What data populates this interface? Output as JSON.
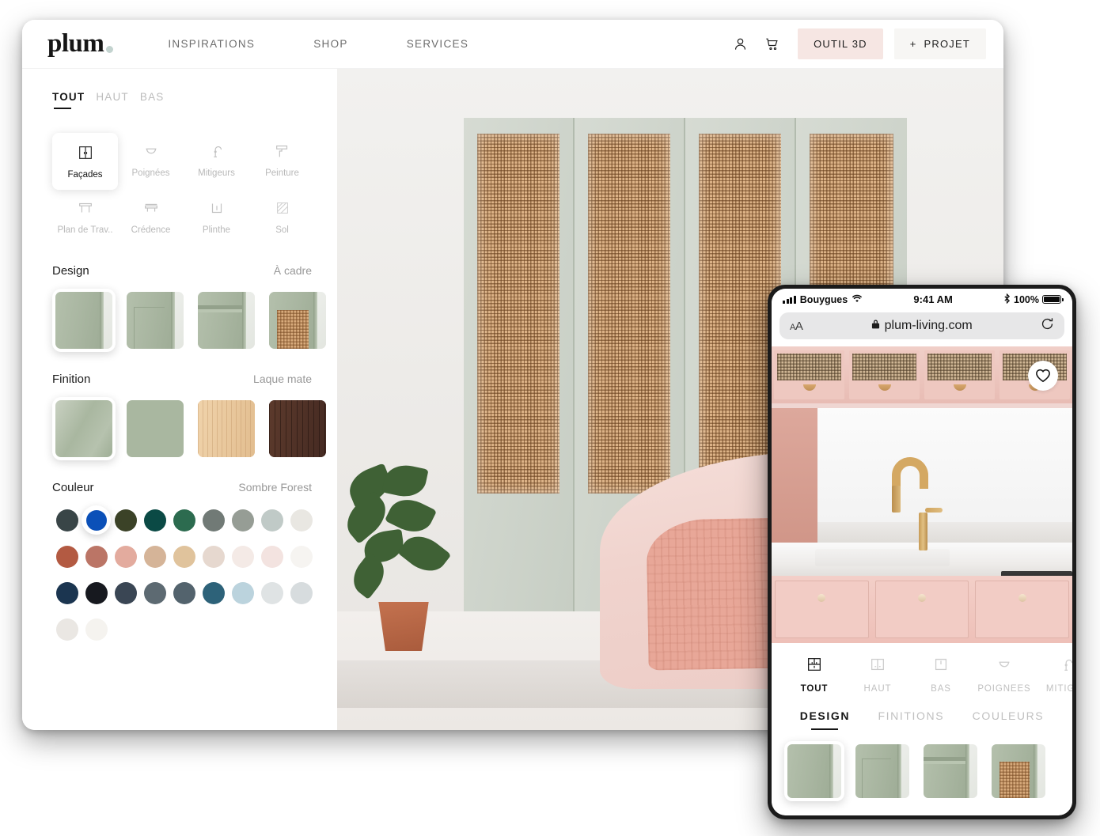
{
  "desktop": {
    "header": {
      "logo": "plum",
      "nav": [
        {
          "label": "INSPIRATIONS"
        },
        {
          "label": "SHOP"
        },
        {
          "label": "SERVICES"
        }
      ],
      "account_icon": "user-icon",
      "cart_icon": "cart-icon",
      "outil_label": "OUTIL 3D",
      "projet_label": "PROJET",
      "projet_plus": "+"
    },
    "segments": [
      {
        "label": "TOUT",
        "active": true
      },
      {
        "label": "HAUT",
        "active": false
      },
      {
        "label": "BAS",
        "active": false
      }
    ],
    "categories": [
      {
        "label": "Façades",
        "icon": "cabinet-door-icon",
        "active": true
      },
      {
        "label": "Poignées",
        "icon": "handle-icon",
        "active": false
      },
      {
        "label": "Mitigeurs",
        "icon": "faucet-icon",
        "active": false
      },
      {
        "label": "Peinture",
        "icon": "paint-roller-icon",
        "active": false
      },
      {
        "label": "Plan  de Trav..",
        "icon": "worktop-icon",
        "active": false
      },
      {
        "label": "Crédence",
        "icon": "backsplash-icon",
        "active": false
      },
      {
        "label": "Plinthe",
        "icon": "plinth-icon",
        "active": false
      },
      {
        "label": "Sol",
        "icon": "floor-icon",
        "active": false
      }
    ],
    "design": {
      "title": "Design",
      "value": "À cadre",
      "options": [
        {
          "name": "slab",
          "selected": true
        },
        {
          "name": "framed",
          "selected": false
        },
        {
          "name": "shaker",
          "selected": false
        },
        {
          "name": "cane",
          "selected": false
        }
      ]
    },
    "finition": {
      "title": "Finition",
      "value": "Laque mate",
      "options": [
        {
          "name": "laque-brillante",
          "selected": true
        },
        {
          "name": "laque-mate",
          "selected": false
        },
        {
          "name": "chene-clair",
          "selected": false
        },
        {
          "name": "noyer-fonce",
          "selected": false
        }
      ]
    },
    "couleur": {
      "title": "Couleur",
      "value": "Sombre Forest",
      "rows": [
        [
          {
            "hex": "#394547",
            "selected": false
          },
          {
            "hex": "#0b50b8",
            "selected": true
          },
          {
            "hex": "#3b4227",
            "selected": false
          },
          {
            "hex": "#0b4a45",
            "selected": false
          },
          {
            "hex": "#2c6b4f",
            "selected": false
          },
          {
            "hex": "#717a76",
            "selected": false
          },
          {
            "hex": "#969d95",
            "selected": false
          },
          {
            "hex": "#c0cac7",
            "selected": false
          },
          {
            "hex": "#e9e7e2",
            "selected": false
          }
        ],
        [
          {
            "hex": "#b35a42",
            "selected": false
          },
          {
            "hex": "#bb7566",
            "selected": false
          },
          {
            "hex": "#e3ab9e",
            "selected": false
          },
          {
            "hex": "#d5b498",
            "selected": false
          },
          {
            "hex": "#e0c39c",
            "selected": false
          },
          {
            "hex": "#e6d8cf",
            "selected": false
          },
          {
            "hex": "#f4eae6",
            "selected": false
          },
          {
            "hex": "#f3e3e0",
            "selected": false
          },
          {
            "hex": "#f6f4f1",
            "selected": false
          }
        ],
        [
          {
            "hex": "#1b3550",
            "selected": false
          },
          {
            "hex": "#17191f",
            "selected": false
          },
          {
            "hex": "#3a4654",
            "selected": false
          },
          {
            "hex": "#5d6a72",
            "selected": false
          },
          {
            "hex": "#53636d",
            "selected": false
          },
          {
            "hex": "#2d6279",
            "selected": false
          },
          {
            "hex": "#bbd3dd",
            "selected": false
          },
          {
            "hex": "#dfe3e4",
            "selected": false
          },
          {
            "hex": "#d7dcde",
            "selected": false
          }
        ],
        [
          {
            "hex": "#eae7e3",
            "selected": false
          },
          {
            "hex": "#f5f3ef",
            "selected": false
          }
        ]
      ]
    },
    "preview_alt": "bedroom-with-sage-cane-wardrobe"
  },
  "phone": {
    "status": {
      "carrier": "Bouygues",
      "signal_icon": "signal-bars-icon",
      "wifi_icon": "wifi-icon",
      "time": "9:41 AM",
      "bluetooth_icon": "bluetooth-icon",
      "battery_percent": "100%",
      "battery_icon": "battery-icon"
    },
    "browser": {
      "text_size_label": "AA",
      "lock_icon": "lock-icon",
      "url": "plum-living.com",
      "reload_icon": "reload-icon"
    },
    "photo": {
      "alt": "pink-kitchen-with-brass-faucet",
      "favorite_icon": "heart-icon"
    },
    "categories": [
      {
        "label": "TOUT",
        "icon": "all-cabinets-icon",
        "active": true
      },
      {
        "label": "HAUT",
        "icon": "upper-cabinet-icon",
        "active": false
      },
      {
        "label": "BAS",
        "icon": "lower-cabinet-icon",
        "active": false
      },
      {
        "label": "POIGNEES",
        "icon": "handle-icon",
        "active": false
      },
      {
        "label": "MITIGEU",
        "icon": "faucet-icon",
        "active": false
      }
    ],
    "tabs": [
      {
        "label": "DESIGN",
        "active": true
      },
      {
        "label": "FINITIONS",
        "active": false
      },
      {
        "label": "COULEURS",
        "active": false
      }
    ],
    "swatches": [
      {
        "name": "slab",
        "selected": true
      },
      {
        "name": "framed",
        "selected": false
      },
      {
        "name": "shaker",
        "selected": false
      },
      {
        "name": "cane",
        "selected": false
      }
    ]
  }
}
